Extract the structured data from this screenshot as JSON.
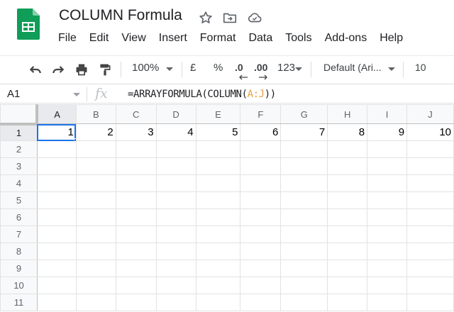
{
  "app": {
    "title": "COLUMN Formula",
    "menu": [
      "File",
      "Edit",
      "View",
      "Insert",
      "Format",
      "Data",
      "Tools",
      "Add-ons",
      "Help"
    ]
  },
  "toolbar": {
    "zoom": "100%",
    "currency": "£",
    "percent": "%",
    "decrease_decimal": ".0",
    "increase_decimal": ".00",
    "more_formats": "123",
    "font": "Default (Ari...",
    "font_size": "10"
  },
  "formula_bar": {
    "name_box": "A1",
    "fx": "fx",
    "formula_prefix": "=ARRAYFORMULA(COLUMN(",
    "formula_ref": "A:J",
    "formula_suffix": "))"
  },
  "grid": {
    "columns": [
      "A",
      "B",
      "C",
      "D",
      "E",
      "F",
      "G",
      "H",
      "I",
      "J"
    ],
    "rows": [
      "1",
      "2",
      "3",
      "4",
      "5",
      "6",
      "7",
      "8",
      "9",
      "10",
      "11"
    ],
    "row1_values": [
      "1",
      "2",
      "3",
      "4",
      "5",
      "6",
      "7",
      "8",
      "9",
      "10"
    ],
    "selected_cell": "A1"
  },
  "colors": {
    "selection": "#1a73e8",
    "sheets_green": "#0f9d58",
    "formula_ref": "#e8a33d"
  }
}
